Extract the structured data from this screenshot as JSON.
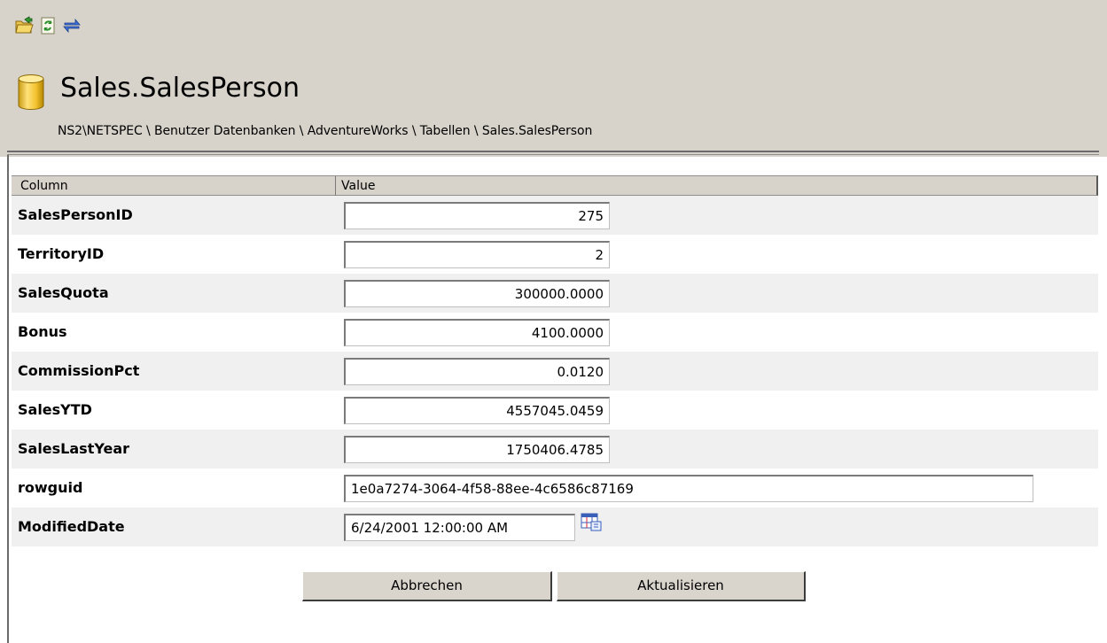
{
  "toolbar": {
    "icons": [
      "open-folder-icon",
      "refresh-icon",
      "swap-icon"
    ]
  },
  "header": {
    "title": "Sales.SalesPerson",
    "breadcrumb": "NS2\\NETSPEC \\ Benutzer Datenbanken \\ AdventureWorks \\ Tabellen \\ Sales.SalesPerson"
  },
  "grid": {
    "columns": [
      "Column",
      "Value"
    ],
    "rows": [
      {
        "label": "SalesPersonID",
        "value": "275"
      },
      {
        "label": "TerritoryID",
        "value": "2"
      },
      {
        "label": "SalesQuota",
        "value": "300000.0000"
      },
      {
        "label": "Bonus",
        "value": "4100.0000"
      },
      {
        "label": "CommissionPct",
        "value": "0.0120"
      },
      {
        "label": "SalesYTD",
        "value": "4557045.0459"
      },
      {
        "label": "SalesLastYear",
        "value": "1750406.4785"
      },
      {
        "label": "rowguid",
        "value": "1e0a7274-3064-4f58-88ee-4c6586c87169"
      },
      {
        "label": "ModifiedDate",
        "value": "6/24/2001 12:00:00 AM"
      }
    ]
  },
  "buttons": {
    "cancel": "Abbrechen",
    "update": "Aktualisieren"
  },
  "colors": {
    "header_bg": "#d7d3cb",
    "row_alt": "#f0f0f0"
  }
}
